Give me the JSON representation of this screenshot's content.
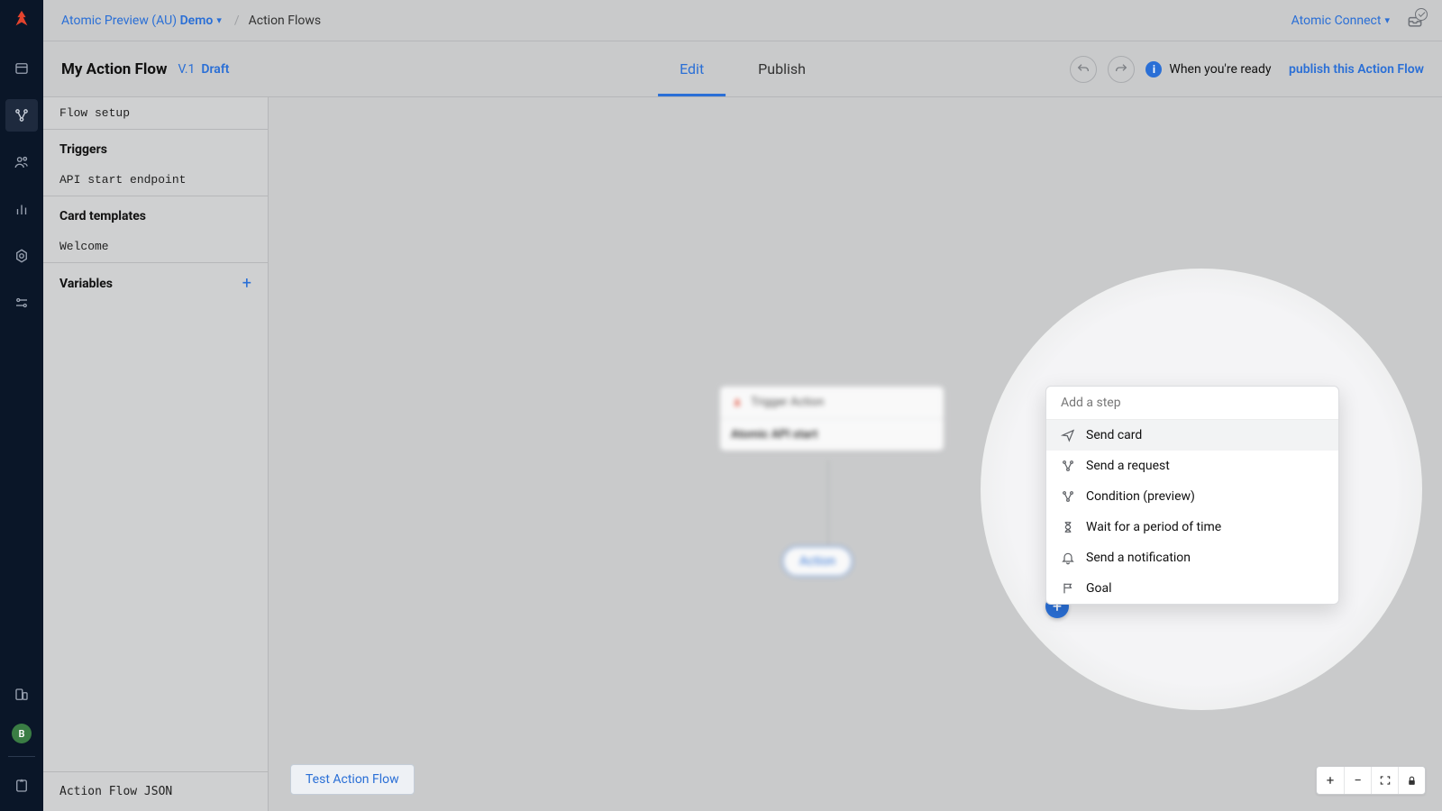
{
  "breadcrumb": {
    "workspace": "Atomic Preview (AU)",
    "env": "Demo",
    "page": "Action Flows",
    "connect": "Atomic Connect"
  },
  "header": {
    "title": "My Action Flow",
    "version": "V.1",
    "status": "Draft",
    "tabs": {
      "edit": "Edit",
      "publish": "Publish"
    },
    "info_prefix": "When you're ready",
    "info_link": "publish this Action Flow"
  },
  "sidebar": {
    "flow_setup": "Flow setup",
    "triggers_head": "Triggers",
    "triggers": [
      "API start endpoint"
    ],
    "templates_head": "Card templates",
    "templates": [
      "Welcome"
    ],
    "variables_head": "Variables",
    "json_link": "Action Flow JSON"
  },
  "canvas": {
    "trigger_label": "Trigger Action",
    "trigger_name": "Atomic API start",
    "action_pill": "Action",
    "test_button": "Test Action Flow"
  },
  "popup": {
    "title": "Add a step",
    "items": [
      {
        "icon": "send-icon",
        "label": "Send card"
      },
      {
        "icon": "request-icon",
        "label": "Send a request"
      },
      {
        "icon": "branch-icon",
        "label": "Condition (preview)"
      },
      {
        "icon": "wait-icon",
        "label": "Wait for a period of time"
      },
      {
        "icon": "bell-icon",
        "label": "Send a notification"
      },
      {
        "icon": "flag-icon",
        "label": "Goal"
      }
    ]
  },
  "avatar": "B"
}
